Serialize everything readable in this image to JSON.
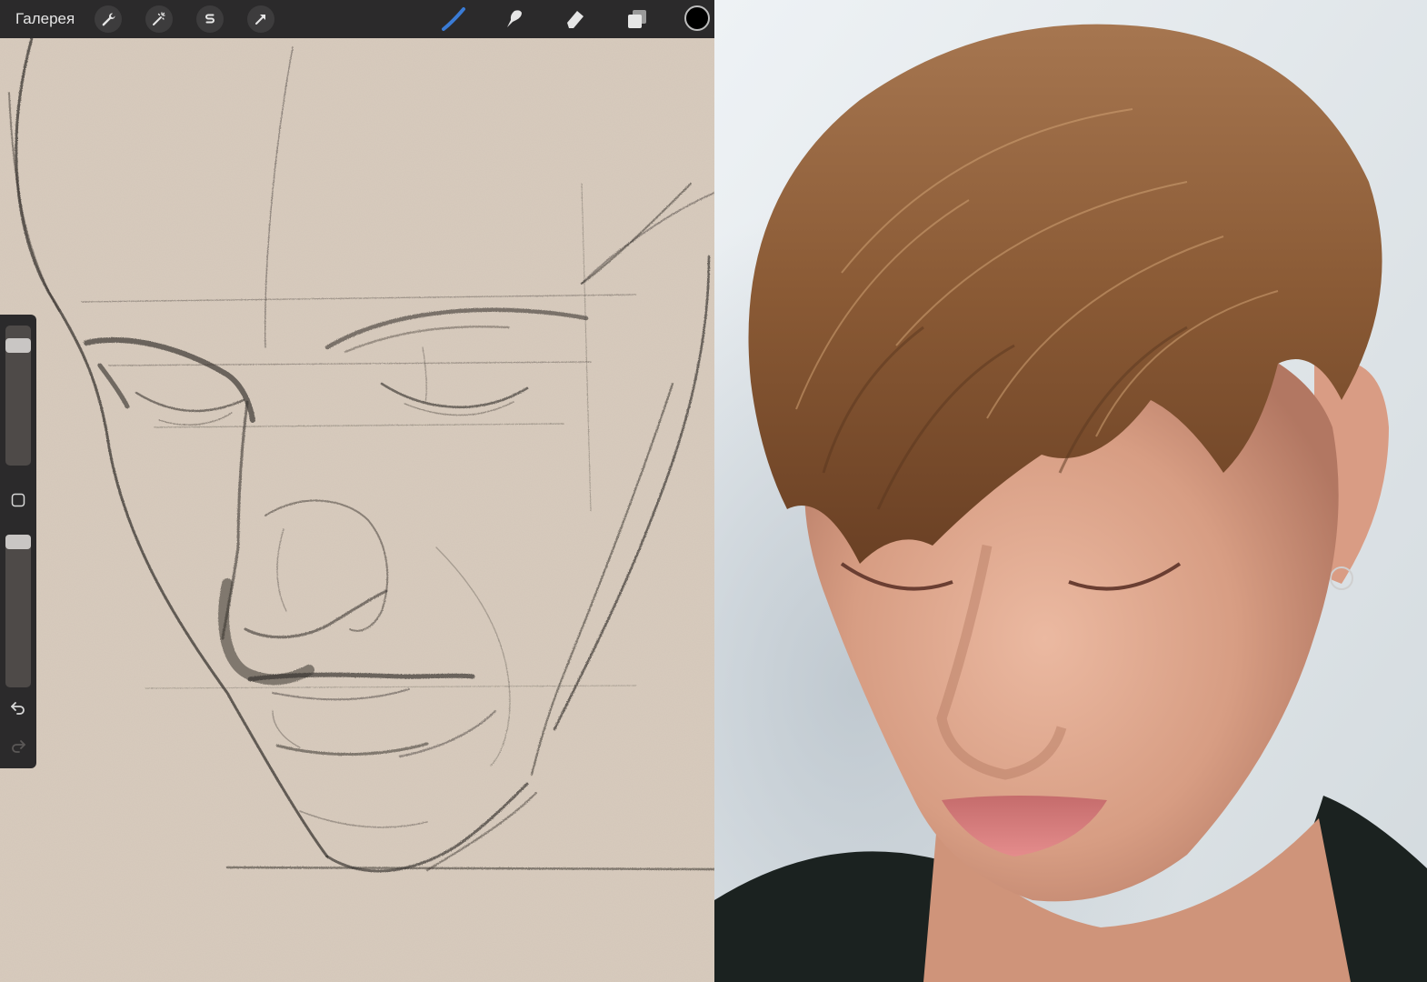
{
  "toolbar": {
    "gallery_label": "Галерея",
    "left_tools": [
      {
        "name": "actions",
        "icon": "wrench-icon"
      },
      {
        "name": "adjustments",
        "icon": "magic-wand-icon"
      },
      {
        "name": "selection",
        "icon": "selection-s-icon"
      },
      {
        "name": "transform",
        "icon": "arrow-cursor-icon"
      }
    ],
    "right_tools": [
      {
        "name": "brush",
        "icon": "brush-icon",
        "active": true
      },
      {
        "name": "smudge",
        "icon": "smudge-finger-icon"
      },
      {
        "name": "eraser",
        "icon": "eraser-icon"
      },
      {
        "name": "layers",
        "icon": "layers-icon"
      }
    ],
    "current_color": "#000000",
    "active_tool_color": "#3a7bd5"
  },
  "sidebar": {
    "brush_size_level": 0.9,
    "opacity_level": 1.0,
    "buttons": [
      "modify-square-icon",
      "undo-icon",
      "redo-icon"
    ]
  },
  "canvas": {
    "paper_color": "#d8cbbd",
    "stroke_color": "#3b3632"
  },
  "reference_photo": {
    "background_color": "#e4e9ed",
    "hair_color": "#8a5a35",
    "skin_color": "#dba58c"
  }
}
